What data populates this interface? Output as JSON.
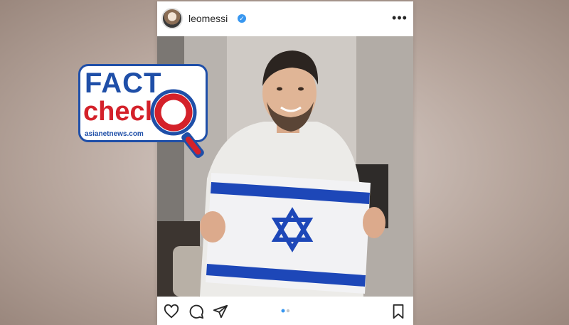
{
  "post": {
    "username": "leomessi",
    "verified_icon": "verified-badge-icon",
    "more_icon": "more-options-icon",
    "carousel_pages": 2,
    "carousel_active_index": 0
  },
  "actions": {
    "like_icon": "heart-icon",
    "comment_icon": "comment-icon",
    "share_icon": "send-icon",
    "save_icon": "bookmark-icon"
  },
  "fact_check_logo": {
    "line1": "FACT",
    "line2": "check",
    "site": "asianetnews.com"
  },
  "colors": {
    "brand_blue": "#1f4fa8",
    "brand_red": "#d4212a",
    "verified_blue": "#3897f0",
    "flag_blue": "#1d47b8",
    "active_dot": "#3897f0"
  }
}
